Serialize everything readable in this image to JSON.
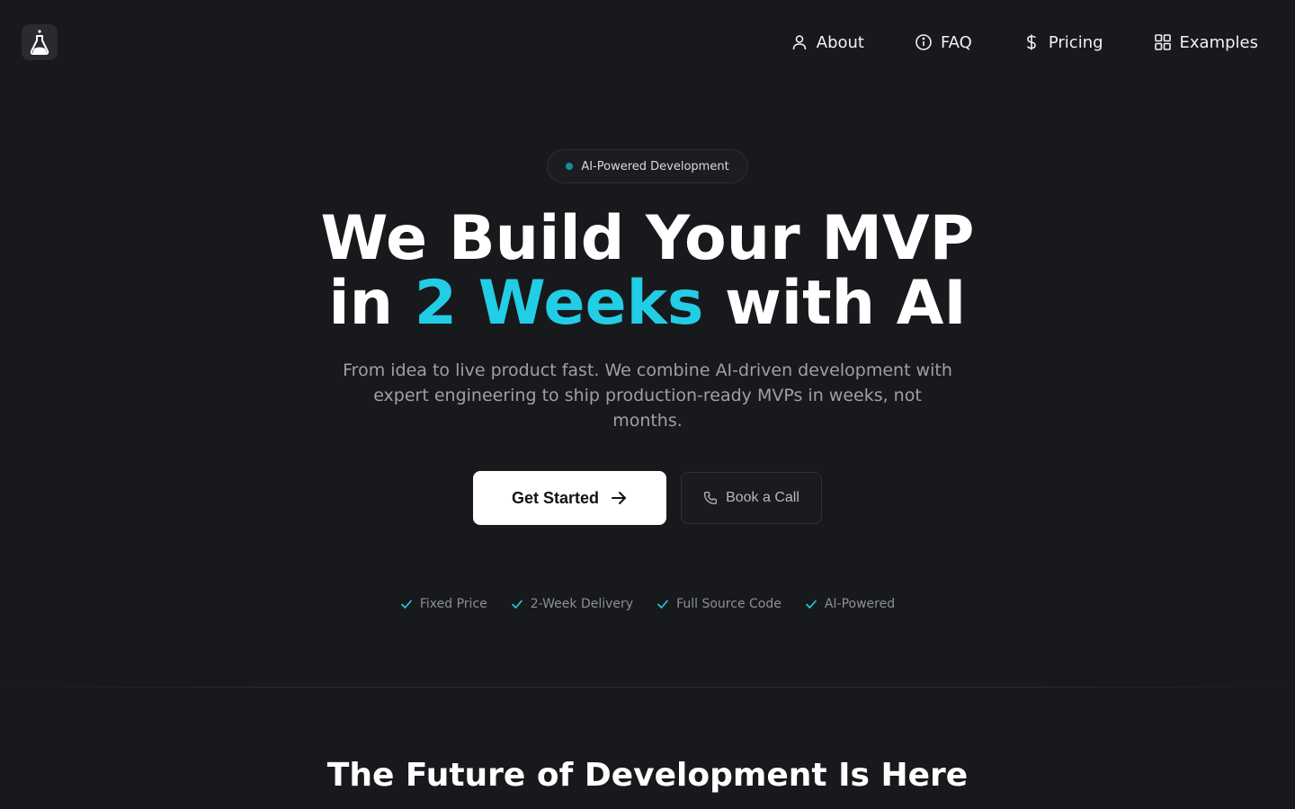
{
  "header": {
    "nav": [
      {
        "label": "About",
        "icon": "user-icon"
      },
      {
        "label": "FAQ",
        "icon": "info-icon"
      },
      {
        "label": "Pricing",
        "icon": "dollar-icon"
      },
      {
        "label": "Examples",
        "icon": "grid-icon"
      }
    ]
  },
  "hero": {
    "badge": "AI-Powered Development",
    "headline_line1": "We Build Your MVP",
    "headline_in": "in ",
    "headline_accent": "2 Weeks",
    "headline_rest": " with AI",
    "subtitle": "From idea to live product fast. We combine AI-driven development with expert engineering to ship production-ready MVPs in weeks, not months.",
    "primary_cta": "Get Started",
    "secondary_cta": "Book a Call",
    "features": [
      "Fixed Price",
      "2-Week Delivery",
      "Full Source Code",
      "AI-Powered"
    ]
  },
  "section": {
    "title": "The Future of Development Is Here"
  },
  "colors": {
    "background": "#18191c",
    "accent": "#22cde6",
    "badge_dot": "#1a8c9e"
  }
}
